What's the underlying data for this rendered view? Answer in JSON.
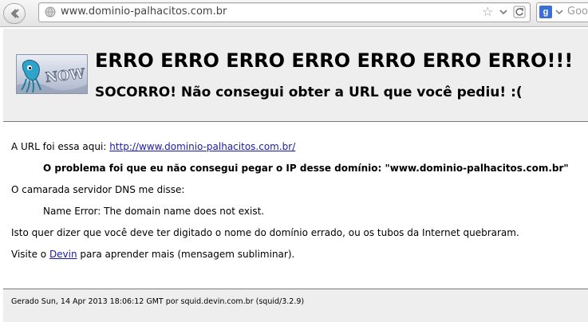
{
  "browser": {
    "url": "www.dominio-palhacitos.com.br",
    "search_placeholder": "Goo",
    "search_engine_badge": "g"
  },
  "page": {
    "logo_text": "NOW",
    "title": "ERRO ERRO ERRO ERRO ERRO ERRO ERRO!!!",
    "subtitle": "SOCORRO! Não consegui obter a URL que você pediu! :(",
    "url_intro": "A URL foi essa aqui: ",
    "url_link": "http://www.dominio-palhacitos.com.br/",
    "problem": "O problema foi que eu não consegui pegar o IP desse domínio: \"www.dominio-palhacitos.com.br\"",
    "dns_intro": "O camarada servidor DNS me disse:",
    "dns_message": "Name Error: The domain name does not exist.",
    "meaning": "Isto quer dizer que você deve ter digitado o nome do domínio errado, ou os tubos da Internet quebraram.",
    "visit_prefix": "Visite o ",
    "visit_link": "Devin",
    "visit_suffix": " para aprender mais (mensagem subliminar).",
    "footer": "Gerado Sun, 14 Apr 2013 18:06:12 GMT por squid.devin.com.br (squid/3.2.9)"
  },
  "colors": {
    "link": "#1a1aa6",
    "header_bg": "#eeeeee"
  }
}
